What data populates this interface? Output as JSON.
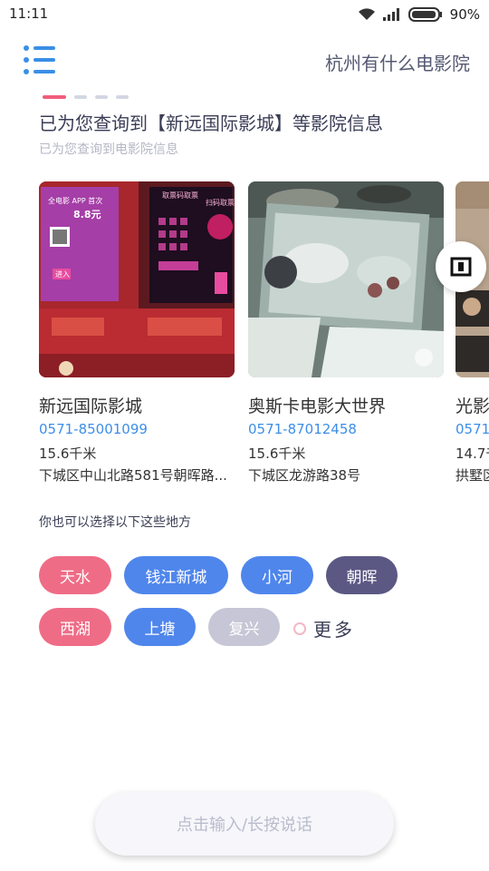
{
  "status": {
    "time": "11:11",
    "battery": "90%"
  },
  "header": {
    "title": "杭州有什么电影院"
  },
  "result": {
    "title": "已为您查询到【新远国际影城】等影院信息",
    "subtitle": "已为您查询到电影院信息"
  },
  "cinemas": [
    {
      "name": "新远国际影城",
      "phone": "0571-85001099",
      "distance": "15.6千米",
      "address": "下城区中山北路581号朝晖路..."
    },
    {
      "name": "奥斯卡电影大世界",
      "phone": "0571-87012458",
      "distance": "15.6千米",
      "address": "下城区龙游路38号"
    },
    {
      "name": "光影",
      "phone": "0571-",
      "distance": "14.7千",
      "address": "拱墅区"
    }
  ],
  "places": {
    "label": "你也可以选择以下这些地方",
    "chips": [
      "天水",
      "钱江新城",
      "小河",
      "朝晖",
      "西湖",
      "上塘",
      "复兴"
    ],
    "more": "更多"
  },
  "input": {
    "placeholder": "点击输入/长按说话"
  },
  "colors": {
    "pink": "#ef6c86",
    "blue": "#4f86ec",
    "purple": "#5b5884",
    "gray": "#c7c6d6",
    "link": "#3d8ee8",
    "dot_active": "#ef5e7b"
  },
  "photo_text": {
    "promo_line1": "全电影 APP 首次",
    "promo_price": "8.8元",
    "promo_enter": "进入",
    "kiosk_title": "取票码取票",
    "kiosk_right": "扫码取票"
  }
}
